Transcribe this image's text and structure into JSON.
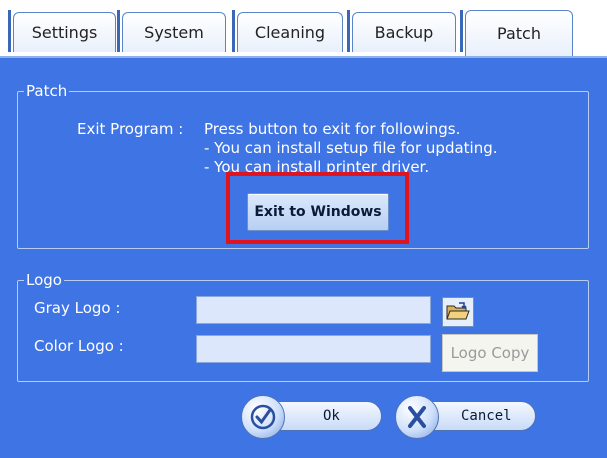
{
  "tabs": {
    "settings": "Settings",
    "system": "System",
    "cleaning": "Cleaning",
    "backup": "Backup",
    "patch": "Patch"
  },
  "patch_group": {
    "title": "Patch",
    "exit_label": "Exit Program :",
    "line1": "Press button to exit for followings.",
    "line2": "- You can install setup file for updating.",
    "line3": "- You can install printer driver.",
    "exit_button": "Exit to Windows"
  },
  "logo_group": {
    "title": "Logo",
    "gray_label": "Gray Logo :",
    "color_label": "Color Logo :",
    "gray_value": "",
    "color_value": "",
    "logo_copy_button": "Logo Copy",
    "open_icon": "open-folder-icon"
  },
  "footer": {
    "ok": "Ok",
    "cancel": "Cancel",
    "ok_icon": "check-icon",
    "cancel_icon": "x-icon"
  },
  "colors": {
    "panel": "#3f74e4",
    "highlight": "#e0141e"
  }
}
